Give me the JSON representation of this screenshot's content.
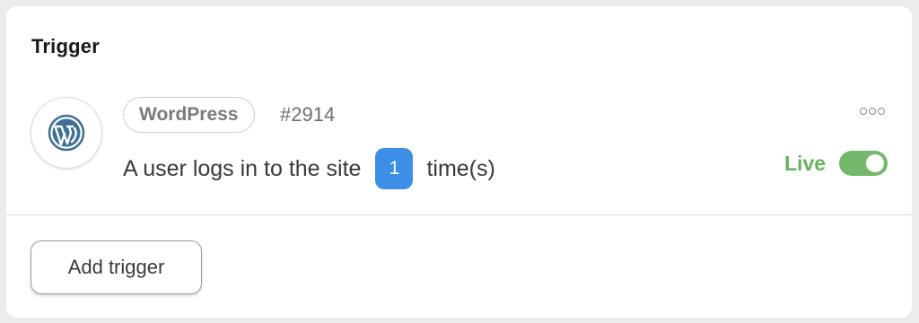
{
  "section": {
    "title": "Trigger"
  },
  "trigger": {
    "logo_icon": "wordpress-icon",
    "app_name": "WordPress",
    "id": "#2914",
    "sentence_before": "A user logs in to the site",
    "count": "1",
    "sentence_after": "time(s)",
    "status_label": "Live",
    "status_on": true,
    "more_icon": "more-options-icon"
  },
  "actions": {
    "add_label": "Add trigger"
  },
  "colors": {
    "accent_blue": "#3d8ee6",
    "live_green": "#68b061",
    "wordpress_blue": "#3f6f96"
  }
}
